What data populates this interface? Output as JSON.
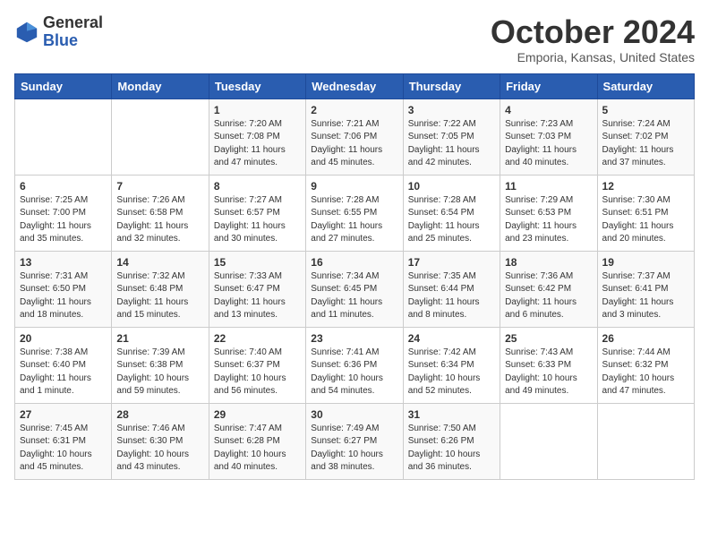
{
  "logo": {
    "general": "General",
    "blue": "Blue"
  },
  "title": "October 2024",
  "location": "Emporia, Kansas, United States",
  "days_of_week": [
    "Sunday",
    "Monday",
    "Tuesday",
    "Wednesday",
    "Thursday",
    "Friday",
    "Saturday"
  ],
  "weeks": [
    [
      {
        "day": "",
        "info": ""
      },
      {
        "day": "",
        "info": ""
      },
      {
        "day": "1",
        "info": "Sunrise: 7:20 AM\nSunset: 7:08 PM\nDaylight: 11 hours and 47 minutes."
      },
      {
        "day": "2",
        "info": "Sunrise: 7:21 AM\nSunset: 7:06 PM\nDaylight: 11 hours and 45 minutes."
      },
      {
        "day": "3",
        "info": "Sunrise: 7:22 AM\nSunset: 7:05 PM\nDaylight: 11 hours and 42 minutes."
      },
      {
        "day": "4",
        "info": "Sunrise: 7:23 AM\nSunset: 7:03 PM\nDaylight: 11 hours and 40 minutes."
      },
      {
        "day": "5",
        "info": "Sunrise: 7:24 AM\nSunset: 7:02 PM\nDaylight: 11 hours and 37 minutes."
      }
    ],
    [
      {
        "day": "6",
        "info": "Sunrise: 7:25 AM\nSunset: 7:00 PM\nDaylight: 11 hours and 35 minutes."
      },
      {
        "day": "7",
        "info": "Sunrise: 7:26 AM\nSunset: 6:58 PM\nDaylight: 11 hours and 32 minutes."
      },
      {
        "day": "8",
        "info": "Sunrise: 7:27 AM\nSunset: 6:57 PM\nDaylight: 11 hours and 30 minutes."
      },
      {
        "day": "9",
        "info": "Sunrise: 7:28 AM\nSunset: 6:55 PM\nDaylight: 11 hours and 27 minutes."
      },
      {
        "day": "10",
        "info": "Sunrise: 7:28 AM\nSunset: 6:54 PM\nDaylight: 11 hours and 25 minutes."
      },
      {
        "day": "11",
        "info": "Sunrise: 7:29 AM\nSunset: 6:53 PM\nDaylight: 11 hours and 23 minutes."
      },
      {
        "day": "12",
        "info": "Sunrise: 7:30 AM\nSunset: 6:51 PM\nDaylight: 11 hours and 20 minutes."
      }
    ],
    [
      {
        "day": "13",
        "info": "Sunrise: 7:31 AM\nSunset: 6:50 PM\nDaylight: 11 hours and 18 minutes."
      },
      {
        "day": "14",
        "info": "Sunrise: 7:32 AM\nSunset: 6:48 PM\nDaylight: 11 hours and 15 minutes."
      },
      {
        "day": "15",
        "info": "Sunrise: 7:33 AM\nSunset: 6:47 PM\nDaylight: 11 hours and 13 minutes."
      },
      {
        "day": "16",
        "info": "Sunrise: 7:34 AM\nSunset: 6:45 PM\nDaylight: 11 hours and 11 minutes."
      },
      {
        "day": "17",
        "info": "Sunrise: 7:35 AM\nSunset: 6:44 PM\nDaylight: 11 hours and 8 minutes."
      },
      {
        "day": "18",
        "info": "Sunrise: 7:36 AM\nSunset: 6:42 PM\nDaylight: 11 hours and 6 minutes."
      },
      {
        "day": "19",
        "info": "Sunrise: 7:37 AM\nSunset: 6:41 PM\nDaylight: 11 hours and 3 minutes."
      }
    ],
    [
      {
        "day": "20",
        "info": "Sunrise: 7:38 AM\nSunset: 6:40 PM\nDaylight: 11 hours and 1 minute."
      },
      {
        "day": "21",
        "info": "Sunrise: 7:39 AM\nSunset: 6:38 PM\nDaylight: 10 hours and 59 minutes."
      },
      {
        "day": "22",
        "info": "Sunrise: 7:40 AM\nSunset: 6:37 PM\nDaylight: 10 hours and 56 minutes."
      },
      {
        "day": "23",
        "info": "Sunrise: 7:41 AM\nSunset: 6:36 PM\nDaylight: 10 hours and 54 minutes."
      },
      {
        "day": "24",
        "info": "Sunrise: 7:42 AM\nSunset: 6:34 PM\nDaylight: 10 hours and 52 minutes."
      },
      {
        "day": "25",
        "info": "Sunrise: 7:43 AM\nSunset: 6:33 PM\nDaylight: 10 hours and 49 minutes."
      },
      {
        "day": "26",
        "info": "Sunrise: 7:44 AM\nSunset: 6:32 PM\nDaylight: 10 hours and 47 minutes."
      }
    ],
    [
      {
        "day": "27",
        "info": "Sunrise: 7:45 AM\nSunset: 6:31 PM\nDaylight: 10 hours and 45 minutes."
      },
      {
        "day": "28",
        "info": "Sunrise: 7:46 AM\nSunset: 6:30 PM\nDaylight: 10 hours and 43 minutes."
      },
      {
        "day": "29",
        "info": "Sunrise: 7:47 AM\nSunset: 6:28 PM\nDaylight: 10 hours and 40 minutes."
      },
      {
        "day": "30",
        "info": "Sunrise: 7:49 AM\nSunset: 6:27 PM\nDaylight: 10 hours and 38 minutes."
      },
      {
        "day": "31",
        "info": "Sunrise: 7:50 AM\nSunset: 6:26 PM\nDaylight: 10 hours and 36 minutes."
      },
      {
        "day": "",
        "info": ""
      },
      {
        "day": "",
        "info": ""
      }
    ]
  ]
}
